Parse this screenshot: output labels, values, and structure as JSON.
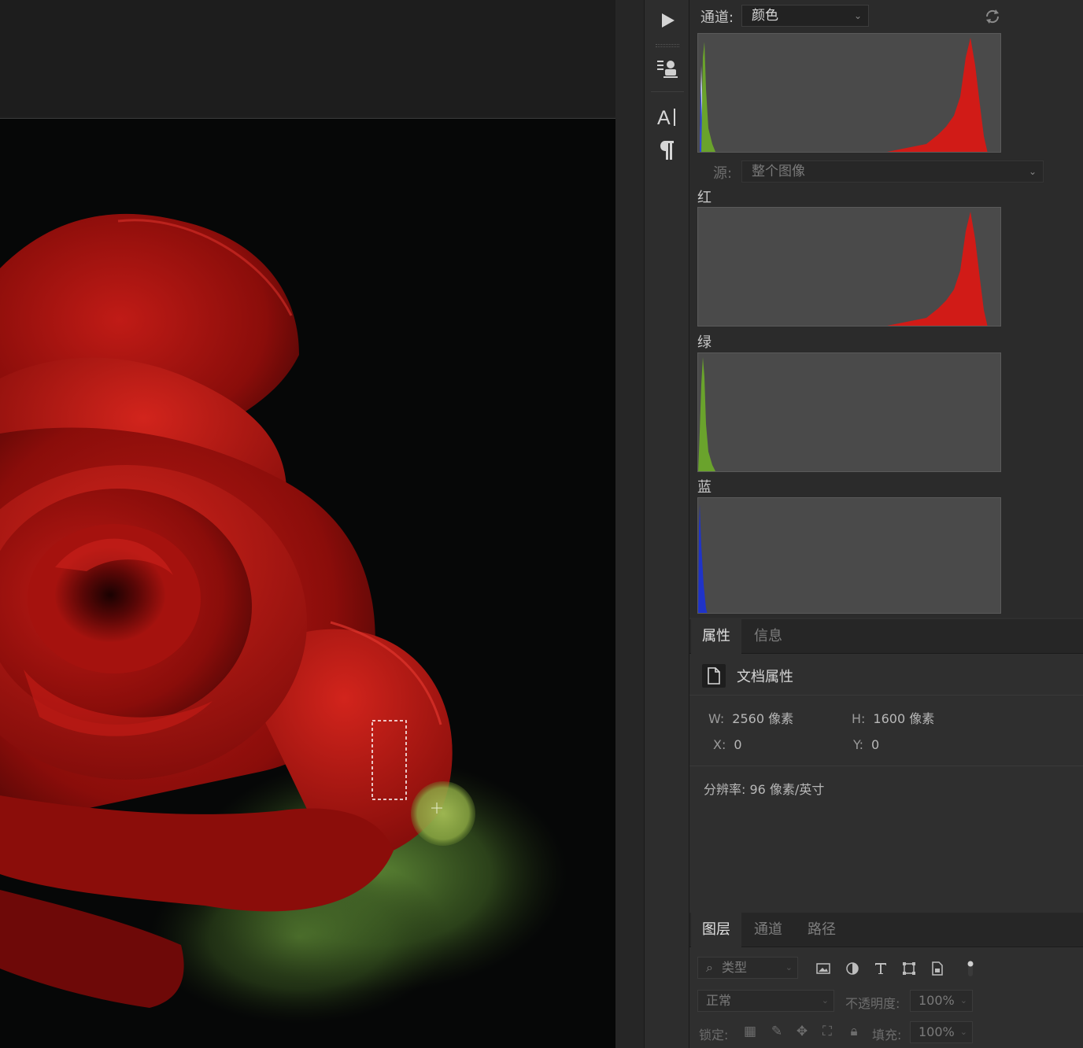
{
  "histogram": {
    "channel_label": "通道:",
    "channel_value": "颜色",
    "source_label": "源:",
    "source_value": "整个图像",
    "channels": [
      {
        "label": "红",
        "color": "#d01818"
      },
      {
        "label": "绿",
        "color": "#5f9a2a"
      },
      {
        "label": "蓝",
        "color": "#1f33c8"
      }
    ]
  },
  "properties": {
    "tabs": [
      "属性",
      "信息"
    ],
    "title": "文档属性",
    "w_label": "W:",
    "w_value": "2560 像素",
    "h_label": "H:",
    "h_value": "1600 像素",
    "x_label": "X:",
    "x_value": "0",
    "y_label": "Y:",
    "y_value": "0",
    "resolution": "分辨率: 96 像素/英寸"
  },
  "layers": {
    "tabs": [
      "图层",
      "通道",
      "路径"
    ],
    "filter_kind": "类型",
    "blend_mode": "正常",
    "opacity_label": "不透明度:",
    "opacity_value": "100%",
    "lock_label": "锁定:",
    "fill_label": "填充:",
    "fill_value": "100%"
  },
  "icons": {
    "play": "play-icon",
    "clone_source": "clone-source-icon",
    "character": "character-icon",
    "paragraph": "paragraph-icon",
    "refresh": "refresh-icon",
    "document": "document-icon"
  }
}
